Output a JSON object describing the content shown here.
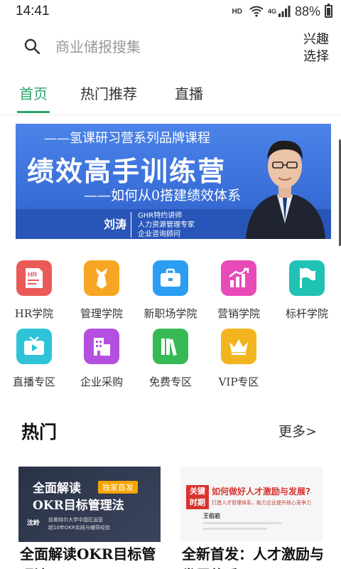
{
  "status": {
    "time": "14:41",
    "hd": "HD",
    "network": "4G",
    "battery": "88%"
  },
  "search": {
    "placeholder": "商业储报搜集",
    "interest_line1": "兴趣",
    "interest_line2": "选择"
  },
  "tabs": [
    {
      "label": "首页",
      "active": true
    },
    {
      "label": "热门推荐"
    },
    {
      "label": "直播"
    }
  ],
  "banner": {
    "line1": "——氢课研习营系列品牌课程",
    "line2": "绩效高手训练营",
    "line3": "——如何从0搭建绩效体系",
    "name": "刘涛",
    "titles": [
      "GHR特约讲师",
      "人力资源管理专家",
      "企业咨询顾问"
    ]
  },
  "categories": [
    {
      "label": "HR学院",
      "icon": "hr-doc-icon",
      "color": "#ea5a57"
    },
    {
      "label": "管理学院",
      "icon": "tie-icon",
      "color": "#f6a623"
    },
    {
      "label": "新职场学院",
      "icon": "briefcase-icon",
      "color": "#2b9df3"
    },
    {
      "label": "营销学院",
      "icon": "growth-chart-icon",
      "color": "#e84ab8"
    },
    {
      "label": "标杆学院",
      "icon": "flag-icon",
      "color": "#20c2b4"
    },
    {
      "label": "直播专区",
      "icon": "tv-play-icon",
      "color": "#2ec3d8"
    },
    {
      "label": "企业采购",
      "icon": "building-icon",
      "color": "#b44fe0"
    },
    {
      "label": "免费专区",
      "icon": "books-icon",
      "color": "#37b956"
    },
    {
      "label": "VIP专区",
      "icon": "crown-icon",
      "color": "#f2b51f"
    }
  ],
  "hot": {
    "title": "热门",
    "more": "更多>"
  },
  "cards": [
    {
      "title": "全面解读OKR目标管理法",
      "thumb_line1": "全面解读",
      "thumb_badge": "独家首发",
      "thumb_line2": "OKR目标管理法",
      "thumb_name": "沈岭",
      "thumb_desc1": "前奥特尔大学中国区运营",
      "thumb_desc2": "超10年OKR实践与辅导经验"
    },
    {
      "title": "全新首发：人才激励与发展体系",
      "thumb_tag1": "关键",
      "thumb_tag2": "时期",
      "thumb_headline": "如何做好人才激励与发展?",
      "thumb_sub": "打造人才管理体系，助力企业提升核心竞争力",
      "thumb_name": "王伯岩"
    }
  ]
}
